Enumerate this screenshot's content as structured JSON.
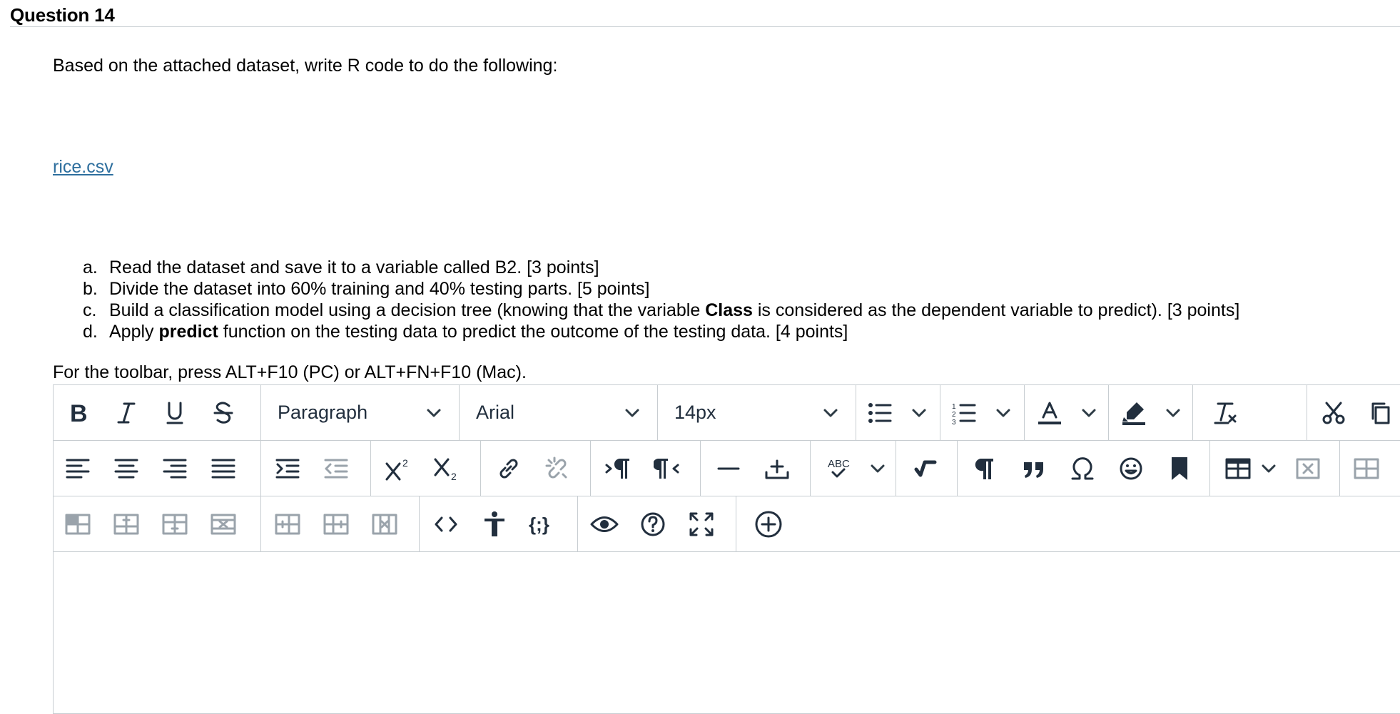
{
  "question": {
    "title": "Question 14",
    "intro": "Based on the attached dataset, write R code to do the following:",
    "attachment": "rice.csv",
    "steps": [
      {
        "marker": "a.",
        "parts": [
          "Read the dataset and save it to a variable called B2. [3 points]"
        ]
      },
      {
        "marker": "b.",
        "parts": [
          "Divide the dataset into 60% training and 40% testing parts. [5 points]"
        ]
      },
      {
        "marker": "c.",
        "parts": [
          "Build a classification model using a decision tree (knowing that the variable ",
          "Class",
          " is considered as the dependent variable to predict). [3 points]"
        ]
      },
      {
        "marker": "d.",
        "parts": [
          "Apply ",
          "predict",
          " function on the testing data to predict the outcome of the testing data. [4 points]"
        ]
      }
    ],
    "toolbar_hint": "For the toolbar, press ALT+F10 (PC) or ALT+FN+F10 (Mac)."
  },
  "editor": {
    "block_format": "Paragraph",
    "font_family": "Arial",
    "font_size": "14px",
    "colors": {
      "icon": "#222f3e",
      "disabled_icon": "#9aa3ab",
      "border": "#c7cdd1",
      "link": "#2e6f9e"
    }
  }
}
